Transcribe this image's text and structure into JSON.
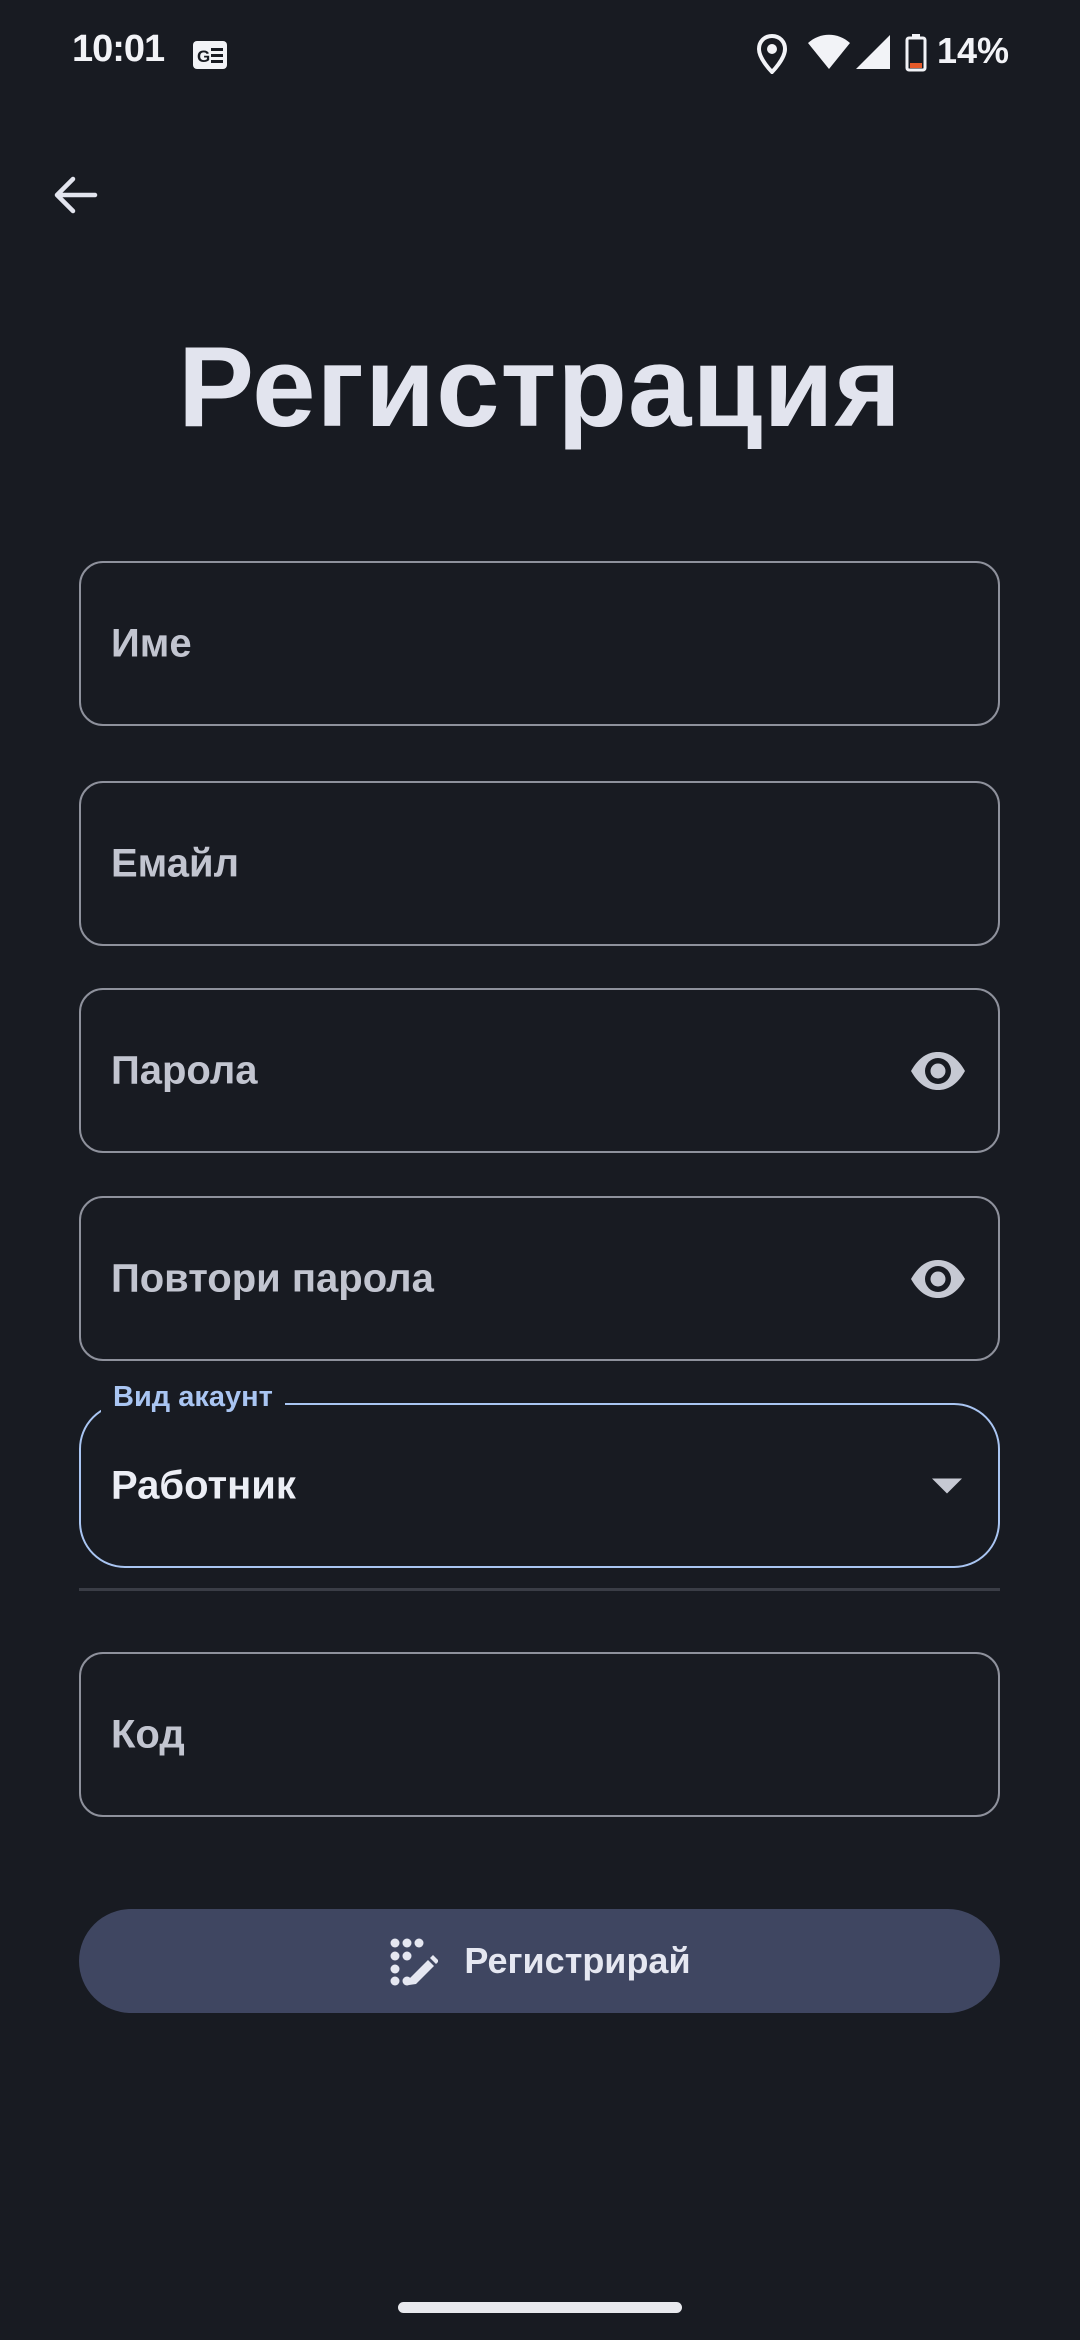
{
  "status_bar": {
    "time": "10:01",
    "battery": "14%",
    "icons": [
      "news-icon",
      "location-icon",
      "wifi-icon",
      "signal-icon",
      "battery-icon"
    ]
  },
  "header": {
    "back_icon": "arrow-left-icon",
    "title": "Регистрация"
  },
  "form": {
    "name_placeholder": "Име",
    "email_placeholder": "Емайл",
    "password_placeholder": "Парола",
    "repeat_password_placeholder": "Повтори парола",
    "account_type": {
      "label": "Вид акаунт",
      "value": "Работник"
    },
    "code_placeholder": "Код",
    "submit_label": "Регистрирай",
    "submit_icon": "magic-wand-icon"
  },
  "colors": {
    "background": "#181b22",
    "accent": "#a9c5f2",
    "button": "#3f4661",
    "outline": "#8e919c"
  }
}
